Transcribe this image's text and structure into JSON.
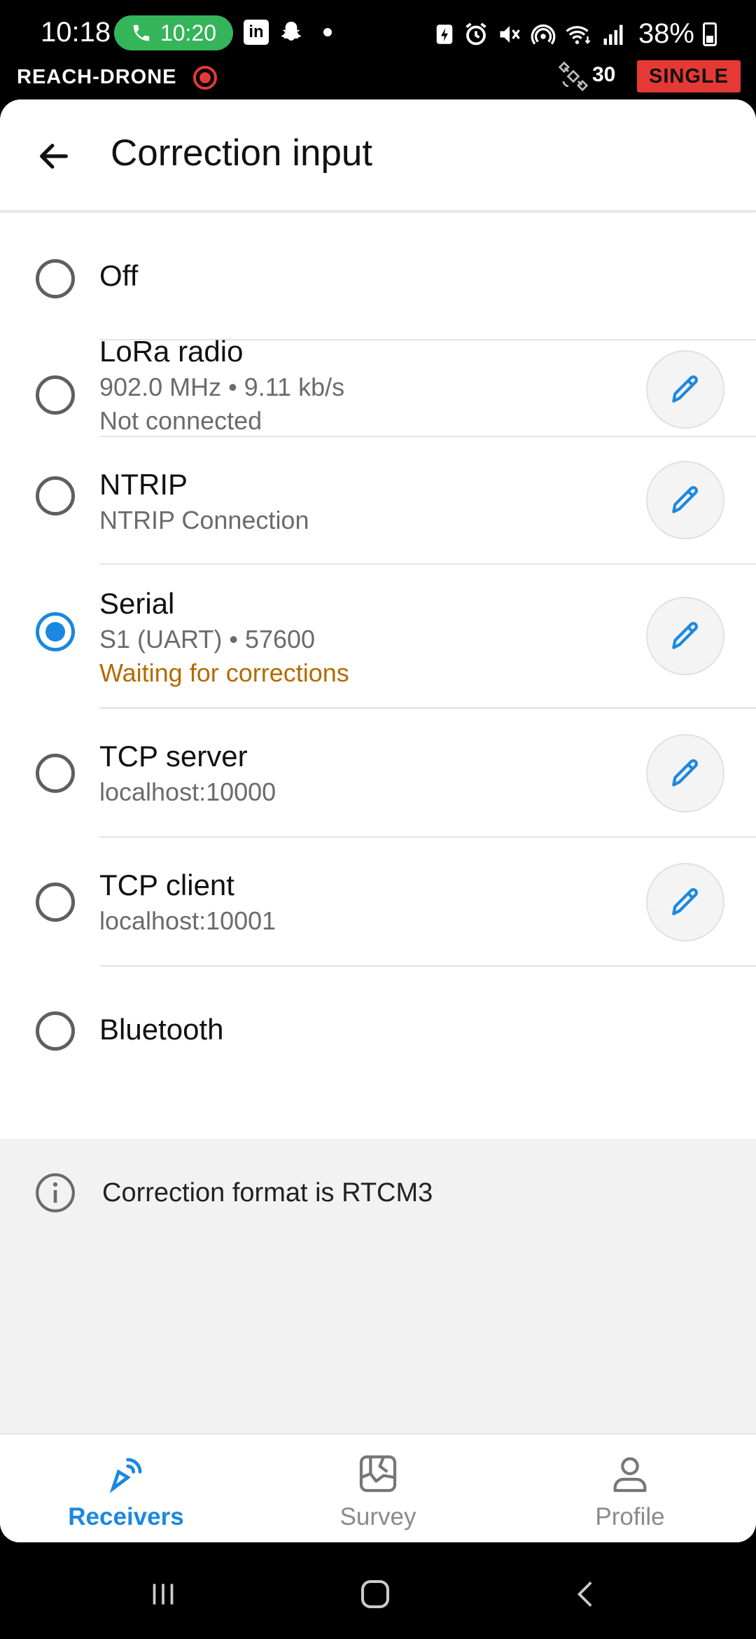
{
  "status_bar": {
    "time": "10:18",
    "call_time": "10:20",
    "linkedin_label": "in",
    "battery": "38%"
  },
  "device": {
    "name": "REACH-DRONE",
    "satellites": "30",
    "solution": "SINGLE"
  },
  "header": {
    "title": "Correction input"
  },
  "options": [
    {
      "title": "Off",
      "selected": false
    },
    {
      "title": "LoRa radio",
      "detail": "902.0 MHz • 9.11 kb/s",
      "status": "Not connected",
      "selected": false
    },
    {
      "title": "NTRIP",
      "detail": "NTRIP Connection",
      "selected": false
    },
    {
      "title": "Serial",
      "detail": "S1 (UART) • 57600",
      "status": "Waiting for corrections",
      "selected": true
    },
    {
      "title": "TCP server",
      "detail": "localhost:10000",
      "selected": false
    },
    {
      "title": "TCP client",
      "detail": "localhost:10001",
      "selected": false
    },
    {
      "title": "Bluetooth",
      "selected": false
    }
  ],
  "info": {
    "text": "Correction format is RTCM3"
  },
  "bottom_nav": [
    {
      "label": "Receivers",
      "icon": "receivers-icon",
      "active": true
    },
    {
      "label": "Survey",
      "icon": "survey-icon",
      "active": false
    },
    {
      "label": "Profile",
      "icon": "profile-icon",
      "active": false
    }
  ],
  "colors": {
    "accent": "#1a88e0",
    "warning": "#b36b00",
    "call_green": "#35b55a",
    "badge_red": "#e53935"
  }
}
